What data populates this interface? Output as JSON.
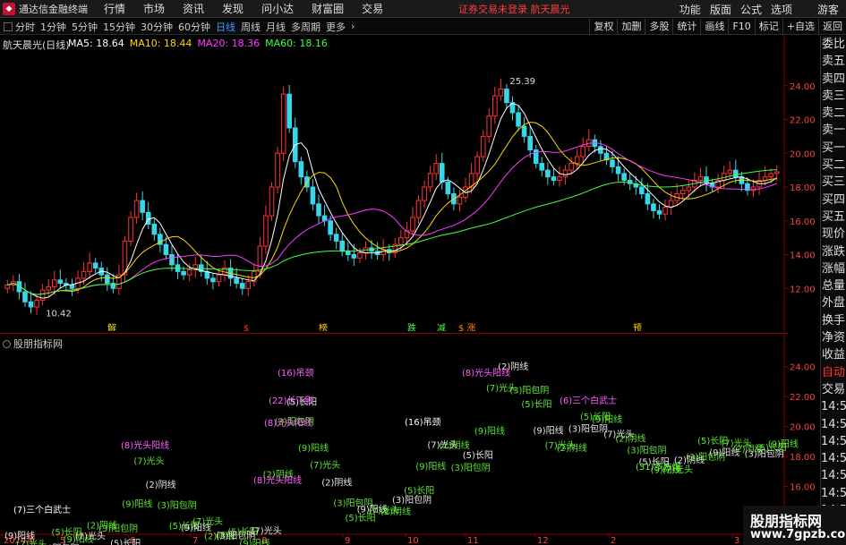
{
  "menubar": {
    "app_title": "通达信金融终端",
    "items": [
      "行情",
      "市场",
      "资讯",
      "发现",
      "问小达",
      "财富圈",
      "交易"
    ],
    "login_status": "证券交易未登录  航天晨光",
    "right_items": [
      "功能",
      "版面",
      "公式",
      "选项"
    ],
    "guest": "游客"
  },
  "toolbar": {
    "periods": [
      "分时",
      "1分钟",
      "5分钟",
      "15分钟",
      "30分钟",
      "60分钟",
      "日线",
      "周线",
      "月线",
      "多周期",
      "更多"
    ],
    "active_period": "日线",
    "right_buttons": [
      "复权",
      "加删",
      "多股",
      "统计",
      "画线",
      "F10",
      "标记",
      "+自选",
      "返回"
    ]
  },
  "stock": {
    "title": "航天晨光(日线)",
    "ma": [
      {
        "label": "MA5: 18.64",
        "color": "#ffffff"
      },
      {
        "label": "MA10: 18.44",
        "color": "#ffd700"
      },
      {
        "label": "MA20: 18.36",
        "color": "#ff3bff"
      },
      {
        "label": "MA60: 18.16",
        "color": "#40ff40"
      }
    ],
    "high_label": "25.39",
    "low_label": "10.42"
  },
  "sub_chart": {
    "title": "股朋指标网"
  },
  "colors": {
    "up": "#ff3333",
    "down": "#36d7e8",
    "ma5": "#ffffff",
    "ma10": "#ffd700",
    "ma20": "#ff3bff",
    "ma60": "#40ff40",
    "axis": "#8b0000",
    "signal_pink": "#ff60ff",
    "signal_green": "#66ff33"
  },
  "chart_data": {
    "type": "candlestick",
    "y_ticks_main": [
      "24.00",
      "22.00",
      "20.00",
      "18.00",
      "16.00",
      "14.00",
      "12.00"
    ],
    "y_ticks_sub": [
      "24.00",
      "22.00",
      "20.00",
      "18.00",
      "16.00",
      "14.00"
    ],
    "x_ticks": [
      "2024年",
      "5",
      "6",
      "7",
      "8",
      "9",
      "10",
      "11",
      "12",
      "2",
      "3"
    ],
    "event_markers": [
      "解",
      "$",
      "榜",
      "跌",
      "减",
      "$ 涨",
      "预"
    ],
    "close_series": [
      12.2,
      12.4,
      11.8,
      11.2,
      10.9,
      11.3,
      11.9,
      12.1,
      12.5,
      12.3,
      12.2,
      12.0,
      12.6,
      13.0,
      13.5,
      13.2,
      12.8,
      12.3,
      12.0,
      12.8,
      14.8,
      16.2,
      17.2,
      16.5,
      15.8,
      15.2,
      14.6,
      14.0,
      13.4,
      13.0,
      12.8,
      13.1,
      13.4,
      13.0,
      12.6,
      12.4,
      12.8,
      13.2,
      12.6,
      12.3,
      12.0,
      12.4,
      13.0,
      14.5,
      16.3,
      18.0,
      20.0,
      23.5,
      21.5,
      19.5,
      18.6,
      18.0,
      17.0,
      16.3,
      16.0,
      15.2,
      14.8,
      14.2,
      14.0,
      13.8,
      14.1,
      14.4,
      14.2,
      14.0,
      14.3,
      14.1,
      14.6,
      15.0,
      15.4,
      16.2,
      17.2,
      18.0,
      18.8,
      19.4,
      18.3,
      17.6,
      17.0,
      17.4,
      18.0,
      18.8,
      19.8,
      21.0,
      22.2,
      23.4,
      23.8,
      23.0,
      22.4,
      21.6,
      21.0,
      20.2,
      19.4,
      19.0,
      18.6,
      18.4,
      18.6,
      19.0,
      19.4,
      19.8,
      20.4,
      20.8,
      20.4,
      20.0,
      19.6,
      19.2,
      18.8,
      18.4,
      18.2,
      18.0,
      17.6,
      17.0,
      16.6,
      16.4,
      16.8,
      17.2,
      17.6,
      17.8,
      18.0,
      18.4,
      18.6,
      18.2,
      18.0,
      18.4,
      18.8,
      19.0,
      18.6,
      18.2,
      17.8,
      18.0,
      18.4,
      18.6,
      18.8,
      18.9
    ],
    "signals": [
      {
        "text": "(16)吊颈",
        "x": 310,
        "y": 47,
        "color": "pink"
      },
      {
        "text": "(22)长下影",
        "x": 300,
        "y": 78,
        "color": "pink"
      },
      {
        "text": "(8)光头阳线",
        "x": 295,
        "y": 103,
        "color": "pink"
      },
      {
        "text": "(8)光头阳线",
        "x": 135,
        "y": 128,
        "color": "pink"
      },
      {
        "text": "(8)光头阳线",
        "x": 516,
        "y": 47,
        "color": "pink"
      },
      {
        "text": "(6)三个白武士",
        "x": 625,
        "y": 78,
        "color": "pink"
      },
      {
        "text": "(16)吊颈",
        "x": 452,
        "y": 102,
        "color": "white"
      },
      {
        "text": "(31)多方炮",
        "x": 710,
        "y": 152,
        "color": "green"
      },
      {
        "text": "(8)光头阳线",
        "x": 283,
        "y": 167,
        "color": "pink"
      },
      {
        "text": "(7)三个白武士",
        "x": 15,
        "y": 200,
        "color": "white"
      }
    ]
  }
}
